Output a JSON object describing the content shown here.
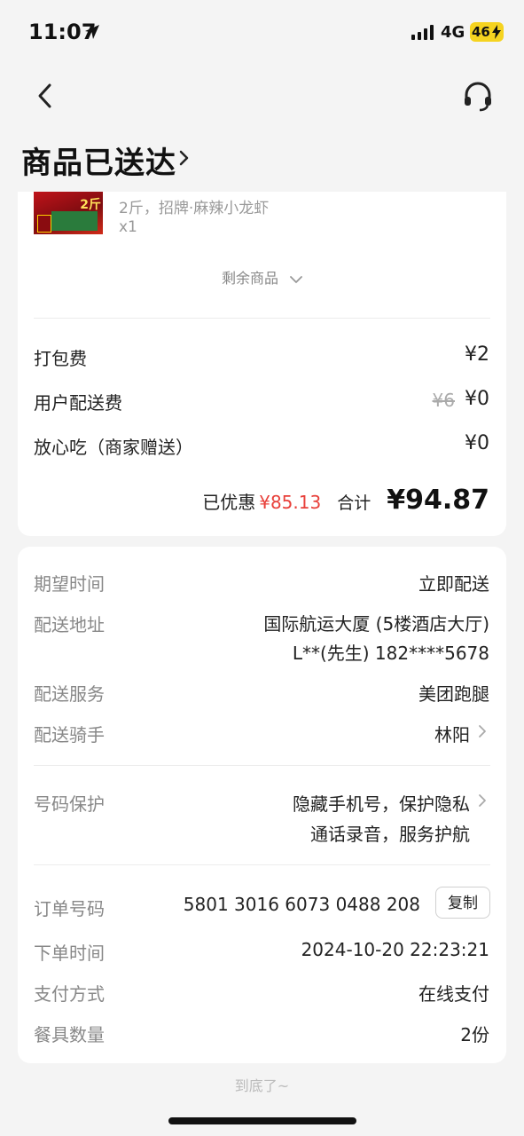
{
  "status_bar": {
    "time": "11:07",
    "network": "4G",
    "battery": "46"
  },
  "header": {
    "title": "商品已送达"
  },
  "order_item": {
    "image_tag": "2斤",
    "spec": "2斤，招牌·麻辣小龙虾",
    "quantity": "x1",
    "more_items_label": "剩余商品"
  },
  "fees": [
    {
      "label": "打包费",
      "value": "¥2",
      "original": ""
    },
    {
      "label": "用户配送费",
      "value": "¥0",
      "original": "¥6"
    },
    {
      "label": "放心吃（商家赠送）",
      "value": "¥0",
      "original": ""
    }
  ],
  "summary": {
    "discount_label": "已优惠",
    "discount_value": "¥85.13",
    "total_label": "合计",
    "total_value": "¥94.87"
  },
  "delivery": {
    "expected_time_label": "期望时间",
    "expected_time_value": "立即配送",
    "address_label": "配送地址",
    "address_line1": "国际航运大厦 (5楼酒店大厅)",
    "address_line2": "L**(先生) 182****5678",
    "service_label": "配送服务",
    "service_value": "美团跑腿",
    "rider_label": "配送骑手",
    "rider_value": "林阳",
    "privacy_label": "号码保护",
    "privacy_line1": "隐藏手机号，保护隐私",
    "privacy_line2": "通话录音，服务护航"
  },
  "order_info": {
    "order_no_label": "订单号码",
    "order_no_value": "5801 3016 6073 0488 208",
    "copy_label": "复制",
    "order_time_label": "下单时间",
    "order_time_value": "2024-10-20 22:23:21",
    "payment_label": "支付方式",
    "payment_value": "在线支付",
    "tableware_label": "餐具数量",
    "tableware_value": "2份"
  },
  "footer": {
    "end_hint": "到底了~"
  },
  "colors": {
    "discount": "#e8403a",
    "battery": "#f5d320",
    "background": "#f4f4f4"
  },
  "icons": [
    "location-arrow-icon",
    "signal-icon",
    "battery-icon",
    "back-chevron-icon",
    "headset-icon",
    "chevron-right-icon",
    "chevron-down-icon"
  ]
}
